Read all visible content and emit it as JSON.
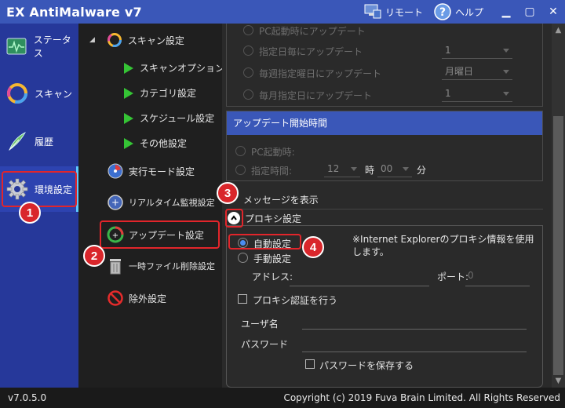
{
  "app": {
    "title": "EX AntiMalware v7",
    "remote_label": "リモート",
    "help_label": "ヘルプ"
  },
  "nav": [
    {
      "label": "ステータス",
      "icon": "status-icon"
    },
    {
      "label": "スキャン",
      "icon": "scan-icon"
    },
    {
      "label": "履歴",
      "icon": "history-icon"
    },
    {
      "label": "環境設定",
      "icon": "gear-icon"
    }
  ],
  "tree": {
    "scan_settings": "スキャン設定",
    "scan_options": "スキャンオプション",
    "category_settings": "カテゴリ設定",
    "schedule_settings": "スケジュール設定",
    "other_settings": "その他設定",
    "exec_mode": "実行モード設定",
    "realtime": "リアルタイム監視設定",
    "update": "アップデート設定",
    "temp_delete": "一時ファイル削除設定",
    "exclusion": "除外設定"
  },
  "schedule": {
    "cutoff_label": "PC起動時にアップデート",
    "every_n_days": "指定日毎にアップデート",
    "every_n_days_value": "1",
    "weekly": "毎週指定曜日にアップデート",
    "weekly_value": "月曜日",
    "monthly": "毎月指定日にアップデート",
    "monthly_value": "1"
  },
  "start_time": {
    "header": "アップデート開始時間",
    "on_pc_start": "PC起動時:",
    "specified_time": "指定時間:",
    "hour_value": "12",
    "hour_unit": "時",
    "minute_value": "00",
    "minute_unit": "分"
  },
  "show_message": "メッセージを表示",
  "proxy": {
    "header": "プロキシ設定",
    "auto": "自動設定",
    "manual": "手動設定",
    "note": "※Internet Explorerのプロキシ情報を使用します。",
    "address_label": "アドレス:",
    "port_label": "ポート:",
    "port_value": "0",
    "auth_label": "プロキシ認証を行う",
    "user_label": "ユーザ名",
    "password_label": "パスワード",
    "save_password": "パスワードを保存する"
  },
  "callouts": [
    "1",
    "2",
    "3",
    "4"
  ],
  "status": {
    "version": "v7.0.5.0",
    "copyright": "Copyright (c) 2019 Fuva Brain Limited. All Rights Reserved"
  },
  "colors": {
    "accent": "#3a57b8",
    "nav": "#26389a",
    "callout": "#d9262b",
    "arrow": "#35c435"
  }
}
